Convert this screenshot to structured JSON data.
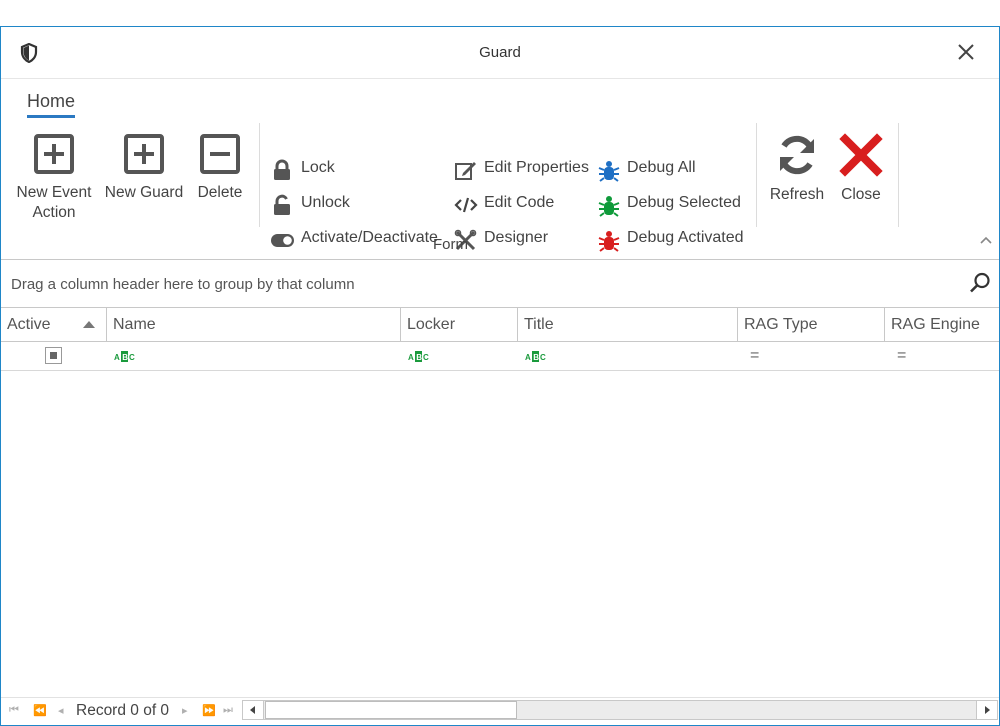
{
  "window": {
    "title": "Guard"
  },
  "ribbon": {
    "tab": "Home",
    "buttons": {
      "new_event_action": "New Event\nAction",
      "new_guard": "New Guard",
      "delete": "Delete",
      "lock": "Lock",
      "unlock": "Unlock",
      "activate_deactivate": "Activate/Deactivate",
      "edit_properties": "Edit Properties",
      "edit_code": "Edit Code",
      "designer": "Designer",
      "debug_all": "Debug All",
      "debug_selected": "Debug Selected",
      "debug_activated": "Debug Activated",
      "refresh": "Refresh",
      "close": "Close"
    },
    "group_label": "Form"
  },
  "grid": {
    "group_panel_text": "Drag a column header here to group by that column",
    "columns": [
      "Active",
      "Name",
      "Locker",
      "Title",
      "RAG Type",
      "RAG Engine"
    ],
    "filter_eq": "="
  },
  "footer": {
    "record_text": "Record 0 of 0"
  },
  "colors": {
    "accent": "#1f86c8",
    "tab_underline": "#2b79c2",
    "debug_all": "#1e6fc4",
    "debug_selected": "#0f9a3a",
    "debug_activated": "#d81e1e",
    "close": "#d81e1e",
    "abc_green": "#1a9a3c"
  },
  "icons": [
    "shield-icon",
    "close-icon",
    "add-box-icon",
    "minus-box-icon",
    "lock-icon",
    "unlock-icon",
    "toggle-icon",
    "edit-properties-icon",
    "code-icon",
    "designer-icon",
    "bug-icon",
    "refresh-icon",
    "close-x-icon",
    "search-icon"
  ]
}
